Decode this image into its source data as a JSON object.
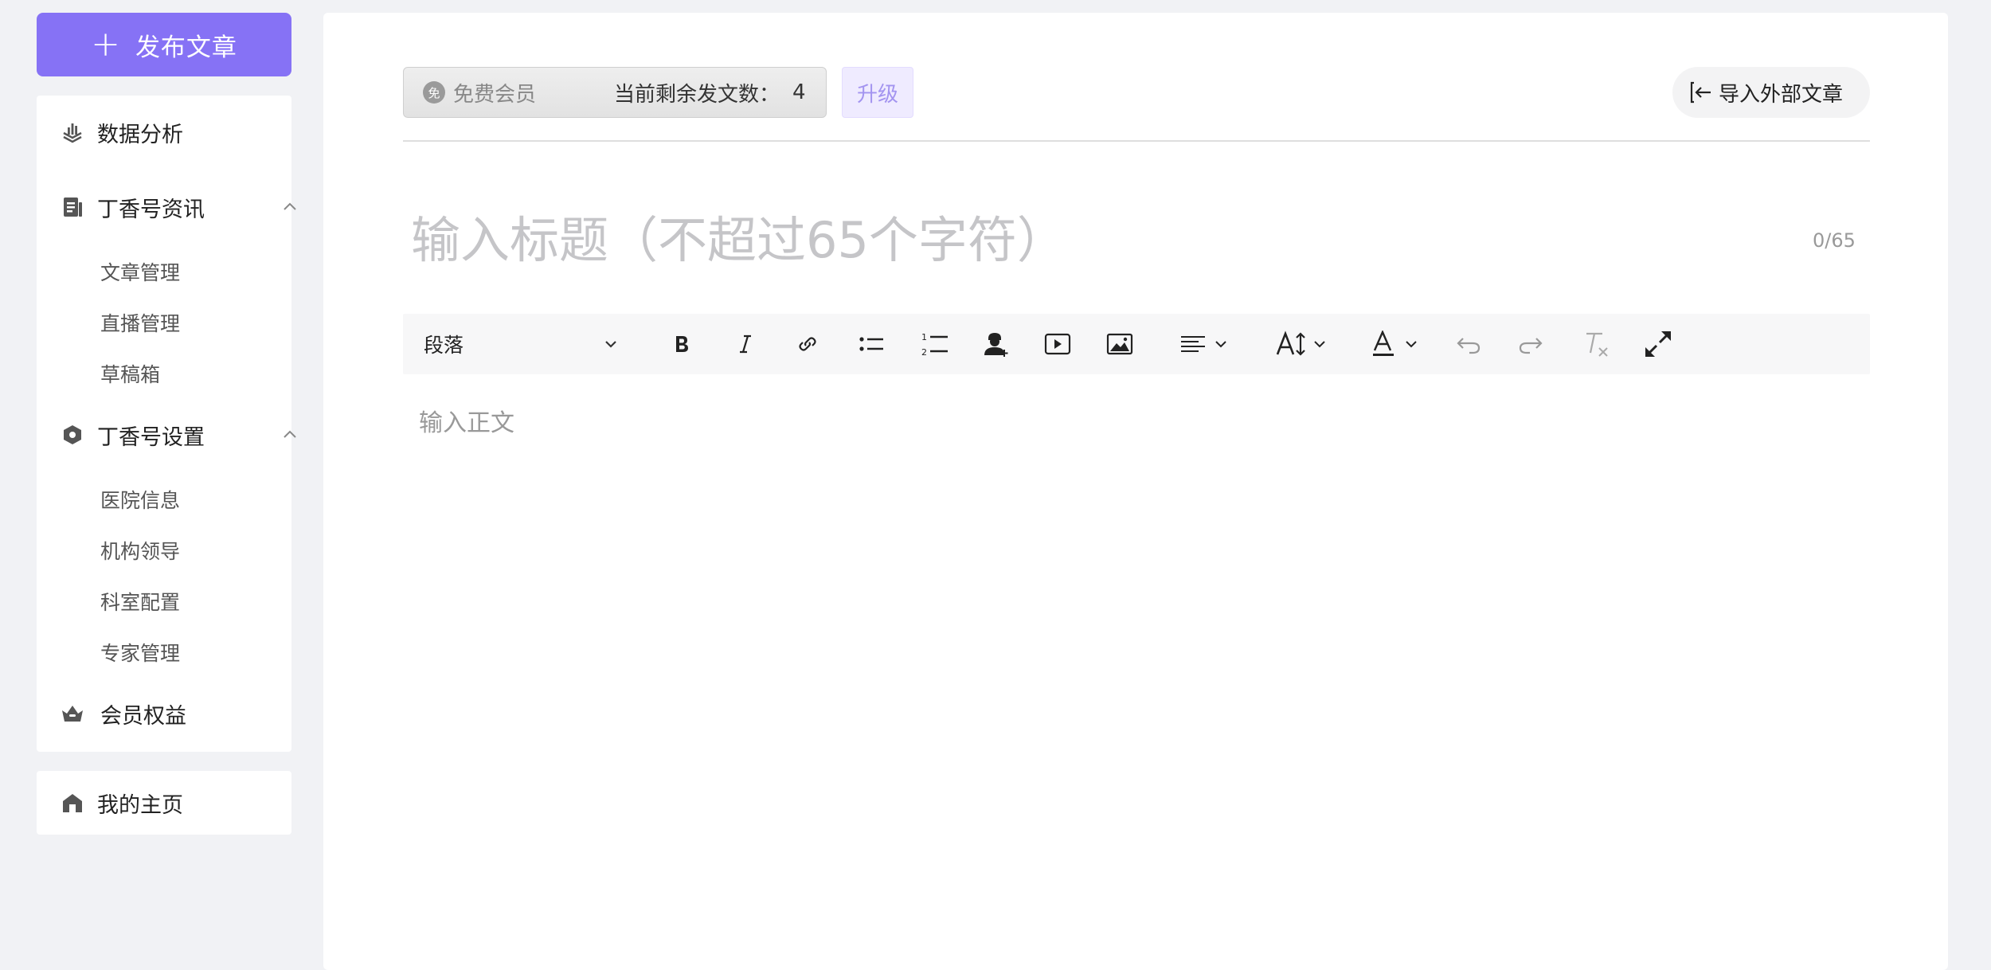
{
  "sidebar": {
    "publish_label": "发布文章",
    "groups": [
      {
        "label": "数据分析",
        "icon": "data-analysis-icon"
      },
      {
        "label": "丁香号资讯",
        "icon": "document-icon",
        "expanded": true,
        "children": [
          {
            "label": "文章管理"
          },
          {
            "label": "直播管理"
          },
          {
            "label": "草稿箱"
          }
        ]
      },
      {
        "label": "丁香号设置",
        "icon": "settings-hexagon-icon",
        "expanded": true,
        "children": [
          {
            "label": "医院信息"
          },
          {
            "label": "机构领导"
          },
          {
            "label": "科室配置"
          },
          {
            "label": "专家管理"
          }
        ]
      },
      {
        "label": "会员权益",
        "icon": "crown-icon"
      }
    ],
    "home_label": "我的主页"
  },
  "header": {
    "member_badge": "免",
    "member_tier": "免费会员",
    "remaining_label": "当前剩余发文数：",
    "remaining_count": "4",
    "upgrade_label": "升级",
    "import_label": "导入外部文章"
  },
  "editor": {
    "title_placeholder": "输入标题（不超过65个字符）",
    "char_count": "0/65",
    "paragraph_style": "段落",
    "body_placeholder": "输入正文",
    "toolbar_icons": [
      "bold-icon",
      "italic-icon",
      "link-icon",
      "bullet-list-icon",
      "numbered-list-icon",
      "add-doctor-icon",
      "video-icon",
      "image-icon",
      "align-icon",
      "font-size-icon",
      "font-color-icon",
      "undo-icon",
      "redo-icon",
      "clear-format-icon",
      "fullscreen-icon"
    ]
  },
  "colors": {
    "accent": "#8672f5",
    "upgrade_bg": "#efebff",
    "upgrade_text": "#a394f0",
    "background": "#f1f2f5"
  }
}
